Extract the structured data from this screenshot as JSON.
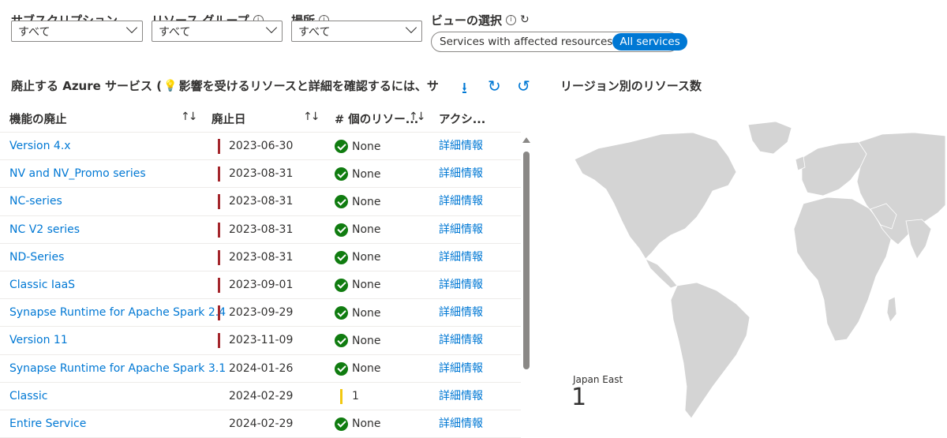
{
  "filters": {
    "subscription": {
      "label": "サブスクリプション",
      "value": "すべて"
    },
    "resource_group": {
      "label": "リソース グループ",
      "value": "すべて"
    },
    "location": {
      "label": "場所",
      "value": "すべて"
    },
    "view": {
      "label": "ビューの選択",
      "option1": "Services with affected resources",
      "option2": "All services",
      "selected": "All services"
    }
  },
  "section": {
    "title": "廃止する Azure サービス (",
    "title_rest": "影響を受けるリソースと詳細を確認するには、サ"
  },
  "map": {
    "title": "リージョン別のリソース数",
    "region_label": "Japan East",
    "region_count": "1"
  },
  "table": {
    "headers": {
      "feature": "機能の廃止",
      "date": "廃止日",
      "resources": "# 個のリソー...",
      "actions": "アクシ..."
    },
    "rows": [
      {
        "name": "Version 4.x",
        "date": "2023-06-30",
        "status": "None",
        "action": "詳細情報",
        "severity": "red"
      },
      {
        "name": "NV and NV_Promo series",
        "date": "2023-08-31",
        "status": "None",
        "action": "詳細情報",
        "severity": "red"
      },
      {
        "name": "NC-series",
        "date": "2023-08-31",
        "status": "None",
        "action": "詳細情報",
        "severity": "red"
      },
      {
        "name": "NC V2 series",
        "date": "2023-08-31",
        "status": "None",
        "action": "詳細情報",
        "severity": "red"
      },
      {
        "name": "ND-Series",
        "date": "2023-08-31",
        "status": "None",
        "action": "詳細情報",
        "severity": "red"
      },
      {
        "name": "Classic IaaS",
        "date": "2023-09-01",
        "status": "None",
        "action": "詳細情報",
        "severity": "red"
      },
      {
        "name": "Synapse Runtime for Apache Spark 2.4",
        "date": "2023-09-29",
        "status": "None",
        "action": "詳細情報",
        "severity": "red"
      },
      {
        "name": "Version 11",
        "date": "2023-11-09",
        "status": "None",
        "action": "詳細情報",
        "severity": "red"
      },
      {
        "name": "Synapse Runtime for Apache Spark 3.1",
        "date": "2024-01-26",
        "status": "None",
        "action": "詳細情報",
        "severity": "none"
      },
      {
        "name": "Classic",
        "date": "2024-02-29",
        "count": "1",
        "action": "詳細情報",
        "severity": "yellow"
      },
      {
        "name": "Entire Service",
        "date": "2024-02-29",
        "status": "None",
        "action": "詳細情報",
        "severity": "none"
      }
    ]
  },
  "colors": {
    "accent": "#0078d4",
    "severity_red": "#a4262c",
    "severity_yellow": "#f2c811",
    "ok_green": "#107c10",
    "map_land": "#d4d4d4"
  }
}
